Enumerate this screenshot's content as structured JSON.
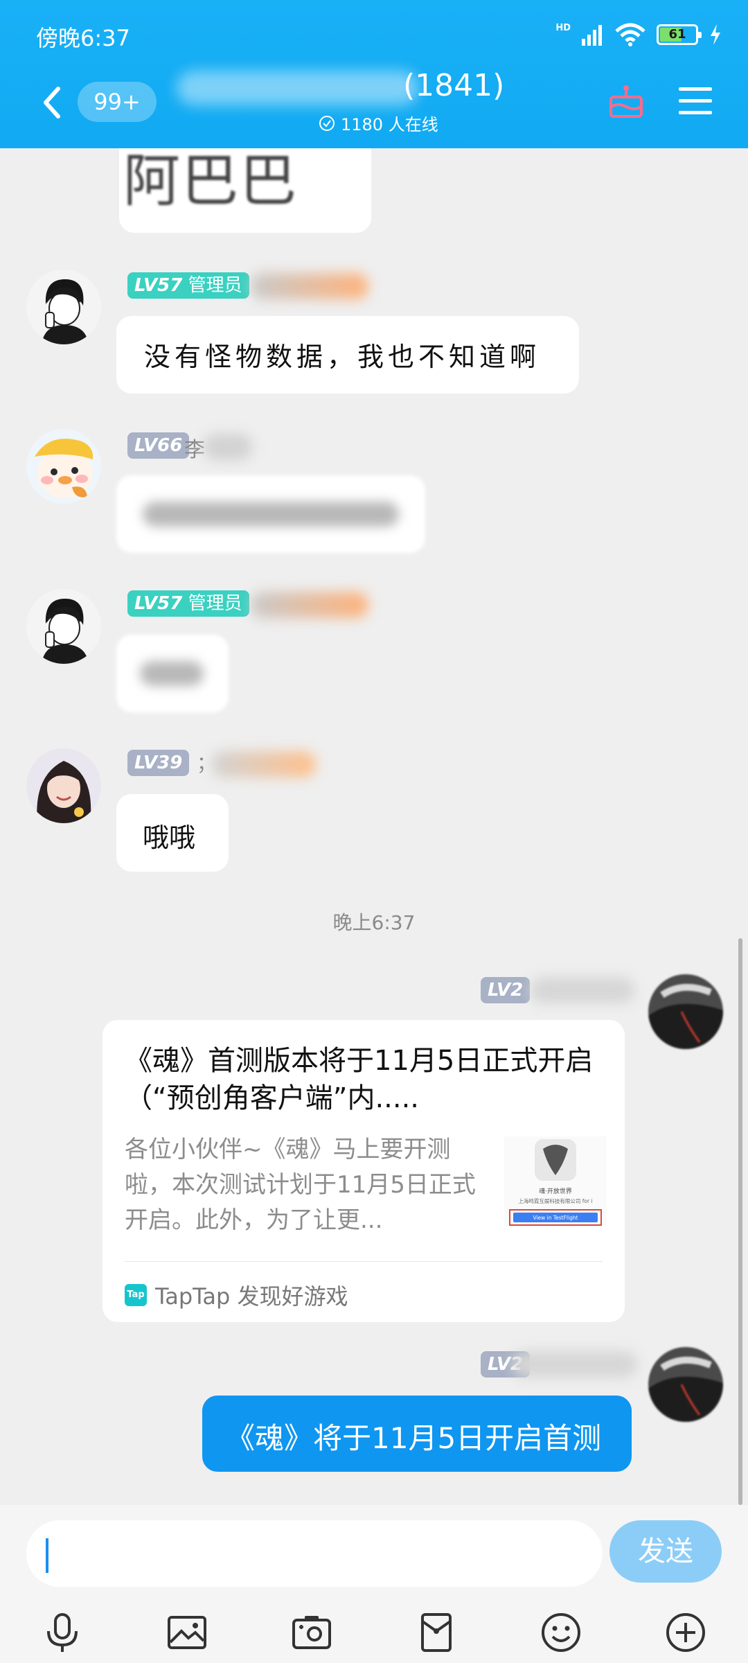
{
  "status_bar": {
    "time": "傍晚6:37",
    "hd": "HD",
    "battery": "61",
    "battery_level": 0.61
  },
  "header": {
    "unread": "99+",
    "member_count": "(1841)",
    "online": "1180 人在线"
  },
  "chat": {
    "image_text": "阿巴巴",
    "messages": [
      {
        "level": "LV57",
        "role": "管理员",
        "text": "没有怪物数据，我也不知道啊"
      },
      {
        "level": "LV66",
        "name_initial": "李"
      },
      {
        "level": "LV57",
        "role": "管理员"
      },
      {
        "level": "LV39",
        "name_initial": "；",
        "text": "哦哦"
      }
    ],
    "time_separator": "晚上6:37",
    "share_card": {
      "level": "LV2",
      "title": "《魂》首测版本将于11月5日正式开启（“预创角客户端”内.....",
      "description": "各位小伙伴~《魂》马上要开测啦，本次测试计划于11月5日正式开启。此外，为了让更...",
      "source": "TapTap 发现好游戏",
      "source_icon": "Tap",
      "thumb_caption": "魂·开放世界",
      "thumb_company": "上海鸣霓互娱科技有限公司 for i",
      "thumb_button": "View in TestFlight"
    },
    "last_message": {
      "level": "LV2",
      "text": "《魂》将于11月5日开启首测"
    }
  },
  "composer": {
    "send_label": "发送"
  },
  "colors": {
    "header": "#11aaf2",
    "admin_badge": "#3ad1c1",
    "level_badge": "#a8b1c5",
    "sent_bubble": "#0f96f0",
    "send_button": "#8ccdf7"
  }
}
